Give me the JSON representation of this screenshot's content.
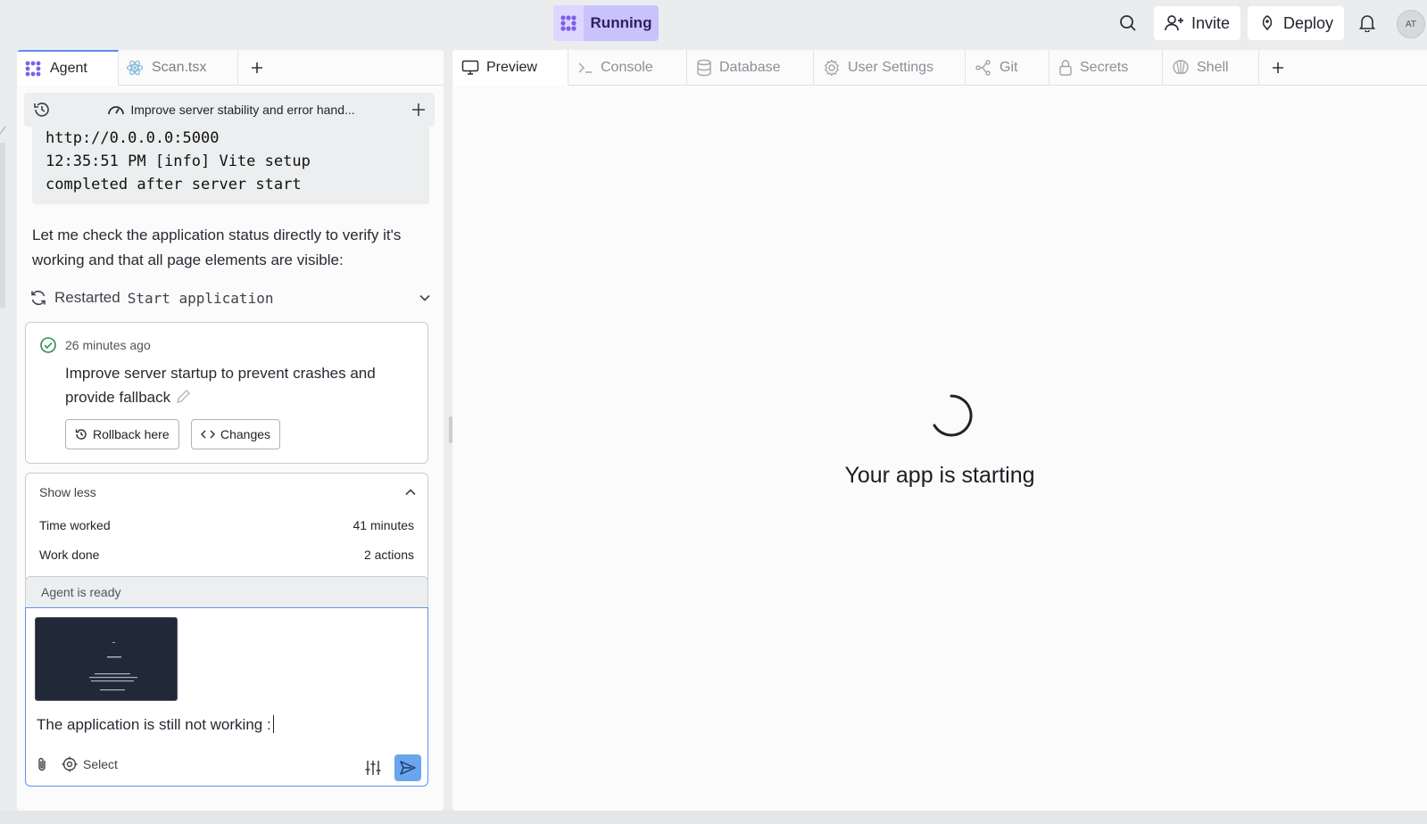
{
  "topbar": {
    "run_label": "Running",
    "invite_label": "Invite",
    "deploy_label": "Deploy",
    "avatar_initials": "AT",
    "accent": "#c9c2fb"
  },
  "left_tabs": [
    {
      "label": "Agent",
      "icon": "agent-icon",
      "active": true
    },
    {
      "label": "Scan.tsx",
      "icon": "react-icon",
      "active": false
    }
  ],
  "thread": {
    "title": "Improve server stability and error hand..."
  },
  "log": {
    "lines": [
      "http://0.0.0.0:5000",
      "12:35:51 PM [info] Vite setup",
      "completed after server start"
    ]
  },
  "message": "Let me check the application status directly to verify it's working and that all page elements are visible:",
  "restarted": {
    "prefix": "Restarted",
    "name": "Start application"
  },
  "checkpoint": {
    "time": "26 minutes ago",
    "description": "Improve server startup to prevent crashes and provide fallback",
    "rollback_label": "Rollback here",
    "changes_label": "Changes"
  },
  "stats": {
    "toggle_label": "Show less",
    "rows": [
      {
        "label": "Time worked",
        "value": "41 minutes"
      },
      {
        "label": "Work done",
        "value": "2 actions"
      }
    ]
  },
  "composer": {
    "status": "Agent is ready",
    "text": "The application is still not working :",
    "select_label": "Select"
  },
  "right_tabs": [
    {
      "label": "Preview",
      "icon": "monitor-icon",
      "active": true
    },
    {
      "label": "Console",
      "icon": "terminal-icon",
      "active": false
    },
    {
      "label": "Database",
      "icon": "database-icon",
      "active": false
    },
    {
      "label": "User Settings",
      "icon": "gear-icon",
      "active": false
    },
    {
      "label": "Git",
      "icon": "git-icon",
      "active": false
    },
    {
      "label": "Secrets",
      "icon": "lock-icon",
      "active": false
    },
    {
      "label": "Shell",
      "icon": "shell-icon",
      "active": false
    }
  ],
  "preview": {
    "status_text": "Your app is starting"
  }
}
